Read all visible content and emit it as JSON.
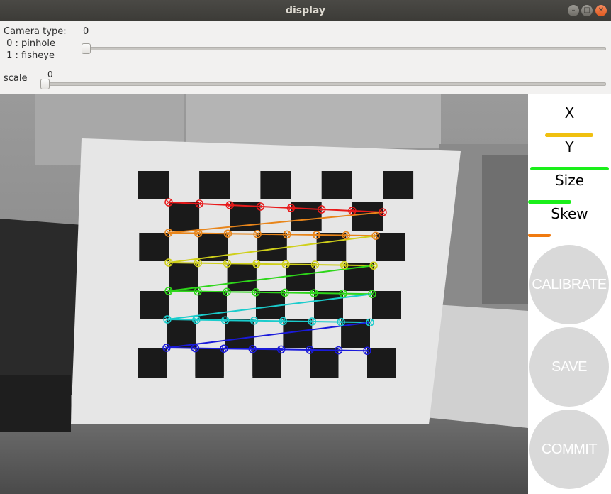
{
  "window": {
    "title": "display"
  },
  "controls": {
    "camera_type": {
      "label": "Camera type:",
      "value": "0",
      "option0": " 0 : pinhole",
      "option1": " 1 : fisheye",
      "level": 0
    },
    "scale": {
      "label": "scale",
      "value": "0",
      "level": 0
    }
  },
  "side_panel": {
    "metrics": [
      {
        "label": "X",
        "level": 0.58,
        "color": "#f0c010"
      },
      {
        "label": "Y",
        "level": 0.95,
        "color": "#1aef1a"
      },
      {
        "label": "Size",
        "level": 0.52,
        "color": "#1aef1a"
      },
      {
        "label": "Skew",
        "level": 0.27,
        "color": "#f07a10"
      }
    ],
    "buttons": {
      "calibrate": "CALIBRATE",
      "save": "SAVE",
      "commit": "COMMIT"
    }
  },
  "detection": {
    "row_colors": [
      "#e8191a",
      "#e8851a",
      "#cfcf1a",
      "#2ed61a",
      "#1acccc",
      "#1a1adb"
    ]
  }
}
